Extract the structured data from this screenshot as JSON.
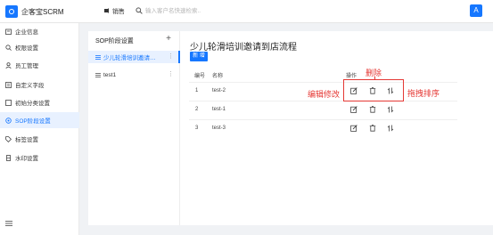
{
  "header": {
    "app_title": "企客宝SCRM",
    "role_label": "销售",
    "search_placeholder": "输入客户名快速检索..",
    "avatar_letter": "A"
  },
  "sidebar": {
    "items": [
      {
        "label": "企业信息",
        "icon": "building-icon"
      },
      {
        "label": "权限设置",
        "icon": "search-key-icon"
      },
      {
        "label": "员工管理",
        "icon": "user-icon"
      },
      {
        "label": "自定义字段",
        "icon": "form-icon"
      },
      {
        "label": "初始分类设置",
        "icon": "square-icon"
      },
      {
        "label": "SOP阶段设置",
        "icon": "sop-icon",
        "active": true
      },
      {
        "label": "标签设置",
        "icon": "tag-icon"
      },
      {
        "label": "水印设置",
        "icon": "watermark-icon"
      }
    ]
  },
  "sop": {
    "title": "SOP阶段设置",
    "add_symbol": "+",
    "more_symbol": "⋮",
    "items": [
      {
        "label": "少儿轮滑培训邀请到...",
        "active": true
      },
      {
        "label": "test1",
        "active": false
      }
    ]
  },
  "detail": {
    "title": "少儿轮滑培训邀请到店流程",
    "new_button": "新 增",
    "columns": {
      "index": "编号",
      "name": "名称",
      "actions": "操作"
    },
    "rows": [
      {
        "index": "1",
        "name": "test-2"
      },
      {
        "index": "2",
        "name": "test-1"
      },
      {
        "index": "3",
        "name": "test-3"
      }
    ]
  },
  "annotations": {
    "edit": "编辑修改",
    "delete": "删除",
    "drag": "拖拽排序",
    "color": "#e53935"
  },
  "colors": {
    "accent": "#1677ff",
    "active_bg": "#e8f1ff"
  }
}
